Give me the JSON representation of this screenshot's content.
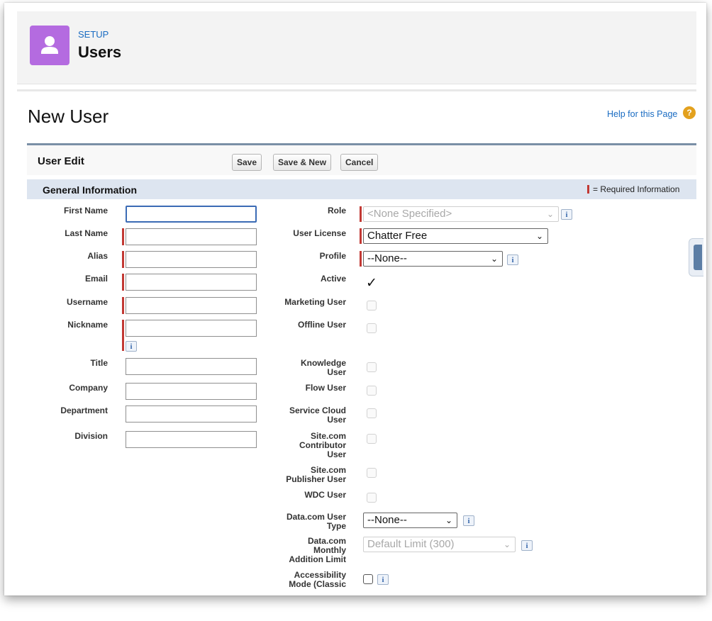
{
  "header": {
    "eyebrow": "SETUP",
    "title": "Users",
    "icon": "user-icon"
  },
  "page": {
    "title": "New User",
    "help_link": "Help for this Page",
    "help_icon": "?"
  },
  "edit": {
    "title": "User Edit",
    "buttons": {
      "save": "Save",
      "save_new": "Save & New",
      "cancel": "Cancel"
    }
  },
  "section": {
    "title": "General Information",
    "required_legend": "= Required Information"
  },
  "left_fields": {
    "first_name": {
      "label": "First Name",
      "value": ""
    },
    "last_name": {
      "label": "Last Name",
      "value": ""
    },
    "alias": {
      "label": "Alias",
      "value": ""
    },
    "email": {
      "label": "Email",
      "value": ""
    },
    "username": {
      "label": "Username",
      "value": ""
    },
    "nickname": {
      "label": "Nickname",
      "value": ""
    },
    "title": {
      "label": "Title",
      "value": ""
    },
    "company": {
      "label": "Company",
      "value": ""
    },
    "department": {
      "label": "Department",
      "value": ""
    },
    "division": {
      "label": "Division",
      "value": ""
    }
  },
  "right_fields": {
    "role": {
      "label": "Role",
      "value": "<None Specified>"
    },
    "user_license": {
      "label": "User License",
      "value": "Chatter Free"
    },
    "profile": {
      "label": "Profile",
      "value": "--None--"
    },
    "active": {
      "label": "Active",
      "checked": true,
      "mark": "✓"
    },
    "marketing_user": {
      "label": "Marketing User",
      "checked": false
    },
    "offline_user": {
      "label": "Offline User",
      "checked": false
    },
    "knowledge_user": {
      "label_1": "Knowledge",
      "label_2": "User",
      "checked": false
    },
    "flow_user": {
      "label": "Flow User",
      "checked": false
    },
    "service_cloud_user": {
      "label_1": "Service Cloud",
      "label_2": "User",
      "checked": false
    },
    "site_contributor_user": {
      "label_1": "Site.com",
      "label_2": "Contributor",
      "label_3": "User",
      "checked": false
    },
    "site_publisher_user": {
      "label_1": "Site.com",
      "label_2": "Publisher User",
      "checked": false
    },
    "wdc_user": {
      "label": "WDC User",
      "checked": false
    },
    "datacom_user_type": {
      "label_1": "Data.com User",
      "label_2": "Type",
      "value": "--None--"
    },
    "datacom_monthly_limit": {
      "label_1": "Data.com",
      "label_2": "Monthly",
      "label_3": "Addition Limit",
      "value": "Default Limit (300)"
    },
    "accessibility_mode": {
      "label_1": "Accessibility",
      "label_2": "Mode (Classic",
      "checked": false
    }
  },
  "info_glyph": "i",
  "colors": {
    "accent": "#b46be0",
    "link": "#1a6cc2",
    "required": "#c23934",
    "section": "#dde5f0",
    "help": "#e3a11e"
  }
}
